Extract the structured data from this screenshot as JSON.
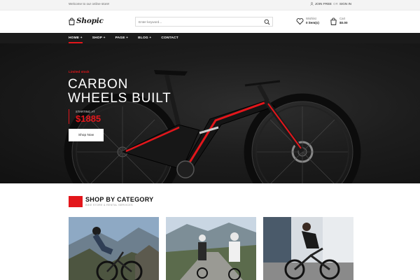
{
  "topbar": {
    "welcome": "Welcome to our online store!",
    "join_label": "JOIN FREE",
    "or_label": "OR",
    "signin_label": "SIGN IN"
  },
  "header": {
    "logo_text": "Shopic",
    "search_placeholder": "Enter keyword...",
    "wishlist_title": "Wishlist",
    "wishlist_count": "0 item(s)",
    "cart_title": "Cart",
    "cart_total": "$0.00"
  },
  "nav": {
    "items": [
      {
        "label": "HOME +"
      },
      {
        "label": "SHOP +"
      },
      {
        "label": "PAGE +"
      },
      {
        "label": "BLOG +"
      },
      {
        "label": "CONTACT"
      }
    ]
  },
  "hero": {
    "tag": "Limited stock",
    "headline_line1": "CARBON",
    "headline_line2": "WHEELS BUILT",
    "starting_at": "STARTING AT",
    "price": "$1885",
    "button_label": "Shop Now"
  },
  "category": {
    "title": "SHOP BY CATEGORY",
    "subtitle": "BIKE STORE & RENTAL SERVICES"
  },
  "colors": {
    "accent": "#e3161b",
    "nav_bg": "#1b1b1b",
    "hero_bg": "#1d1d1d"
  },
  "icons": {
    "logo": "shopping-bag-icon",
    "account": "person-icon",
    "search": "search-icon",
    "wishlist": "heart-icon",
    "cart": "cart-bag-icon"
  }
}
